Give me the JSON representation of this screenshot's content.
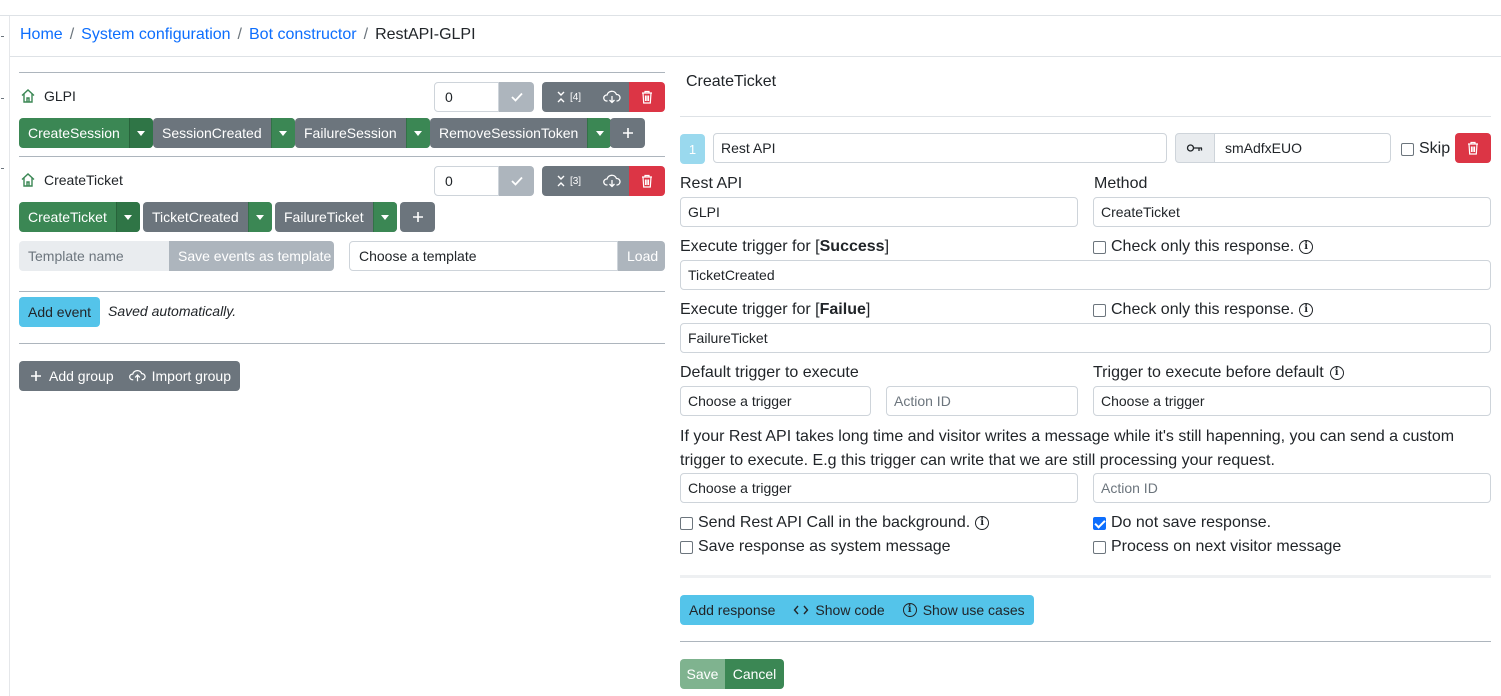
{
  "breadcrumb": {
    "items": [
      "Home",
      "System configuration",
      "Bot constructor"
    ],
    "current": "RestAPI-GLPI",
    "separator": "/"
  },
  "left": {
    "groups": [
      {
        "name": "GLPI",
        "priority": "0",
        "collapse_count": "[4]",
        "events": [
          {
            "label": "CreateSession",
            "style": "green"
          },
          {
            "label": "SessionCreated",
            "style": "gray"
          },
          {
            "label": "FailureSession",
            "style": "gray"
          },
          {
            "label": "RemoveSessionToken",
            "style": "gray"
          }
        ]
      },
      {
        "name": "CreateTicket",
        "priority": "0",
        "collapse_count": "[3]",
        "events": [
          {
            "label": "CreateTicket",
            "style": "green"
          },
          {
            "label": "TicketCreated",
            "style": "gray"
          },
          {
            "label": "FailureTicket",
            "style": "gray"
          }
        ]
      }
    ],
    "template": {
      "name_placeholder": "Template name",
      "save_label": "Save events as template",
      "choose_placeholder": "Choose a template",
      "load_label": "Load"
    },
    "add_event_label": "Add event",
    "saved_note": "Saved automatically.",
    "add_group_label": "Add group",
    "import_group_label": "Import group"
  },
  "right": {
    "title": "CreateTicket",
    "action": {
      "index": "1",
      "type_value": "Rest API",
      "key_value": "smAdfxEUO",
      "skip_label": "Skip"
    },
    "rest_api_label": "Rest API",
    "rest_api_value": "GLPI",
    "method_label": "Method",
    "method_value": "CreateTicket",
    "success_prefix": "Execute trigger for [",
    "success_word": "Success",
    "success_suffix": "]",
    "success_value": "TicketCreated",
    "failure_prefix": "Execute trigger for [",
    "failure_word": "Failue",
    "failure_suffix": "]",
    "failure_value": "FailureTicket",
    "check_only_label": "Check only this response.",
    "default_trigger_label": "Default trigger to execute",
    "before_default_label": "Trigger to execute before default",
    "choose_trigger_placeholder": "Choose a trigger",
    "action_id_placeholder": "Action ID",
    "help_text": "If your Rest API takes long time and visitor writes a message while it's still hapenning, you can send a custom trigger to execute. E.g this trigger can write that we are still processing your request.",
    "options": {
      "background": {
        "label": "Send Rest API Call in the background.",
        "checked": false
      },
      "system_message": {
        "label": "Save response as system message",
        "checked": false
      },
      "do_not_save": {
        "label": "Do not save response.",
        "checked": true
      },
      "next_message": {
        "label": "Process on next visitor message",
        "checked": false
      }
    },
    "add_response_label": "Add response",
    "show_code_label": "Show code",
    "show_use_cases_label": "Show use cases",
    "save_label": "Save",
    "cancel_label": "Cancel"
  },
  "colors": {
    "link": "#0d6efd",
    "green": "#3b8754",
    "gray": "#6c757d",
    "red": "#dc3545",
    "info": "#54c4ea"
  }
}
